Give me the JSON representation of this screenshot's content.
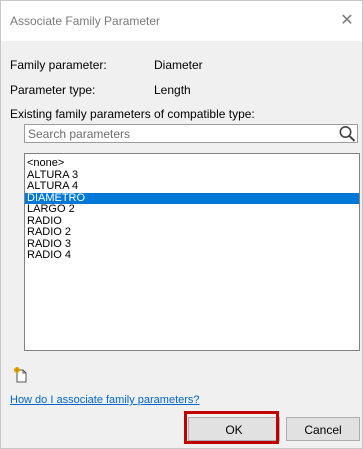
{
  "window": {
    "title": "Associate Family Parameter",
    "close_glyph": "✕"
  },
  "fields": {
    "family_parameter_label": "Family parameter:",
    "family_parameter_value": "Diameter",
    "parameter_type_label": "Parameter type:",
    "parameter_type_value": "Length",
    "existing_label": "Existing family parameters of compatible type:"
  },
  "search": {
    "placeholder": "Search parameters",
    "value": "",
    "icon": "search-icon"
  },
  "parameters": {
    "items": [
      "<none>",
      "ALTURA 3",
      "ALTURA 4",
      "DIAMETRO",
      "LARGO 2",
      "RADIO",
      "RADIO 2",
      "RADIO 3",
      "RADIO 4"
    ],
    "selected": "DIAMETRO",
    "selection_color": "#0078d7"
  },
  "new_parameter": {
    "icon": "new-parameter-icon"
  },
  "help_link": "How do I associate family parameters?",
  "buttons": {
    "ok": "OK",
    "cancel": "Cancel"
  },
  "annotation": {
    "highlight_color": "#c00000",
    "highlights": "ok-button"
  },
  "link_color": "#0066cc"
}
